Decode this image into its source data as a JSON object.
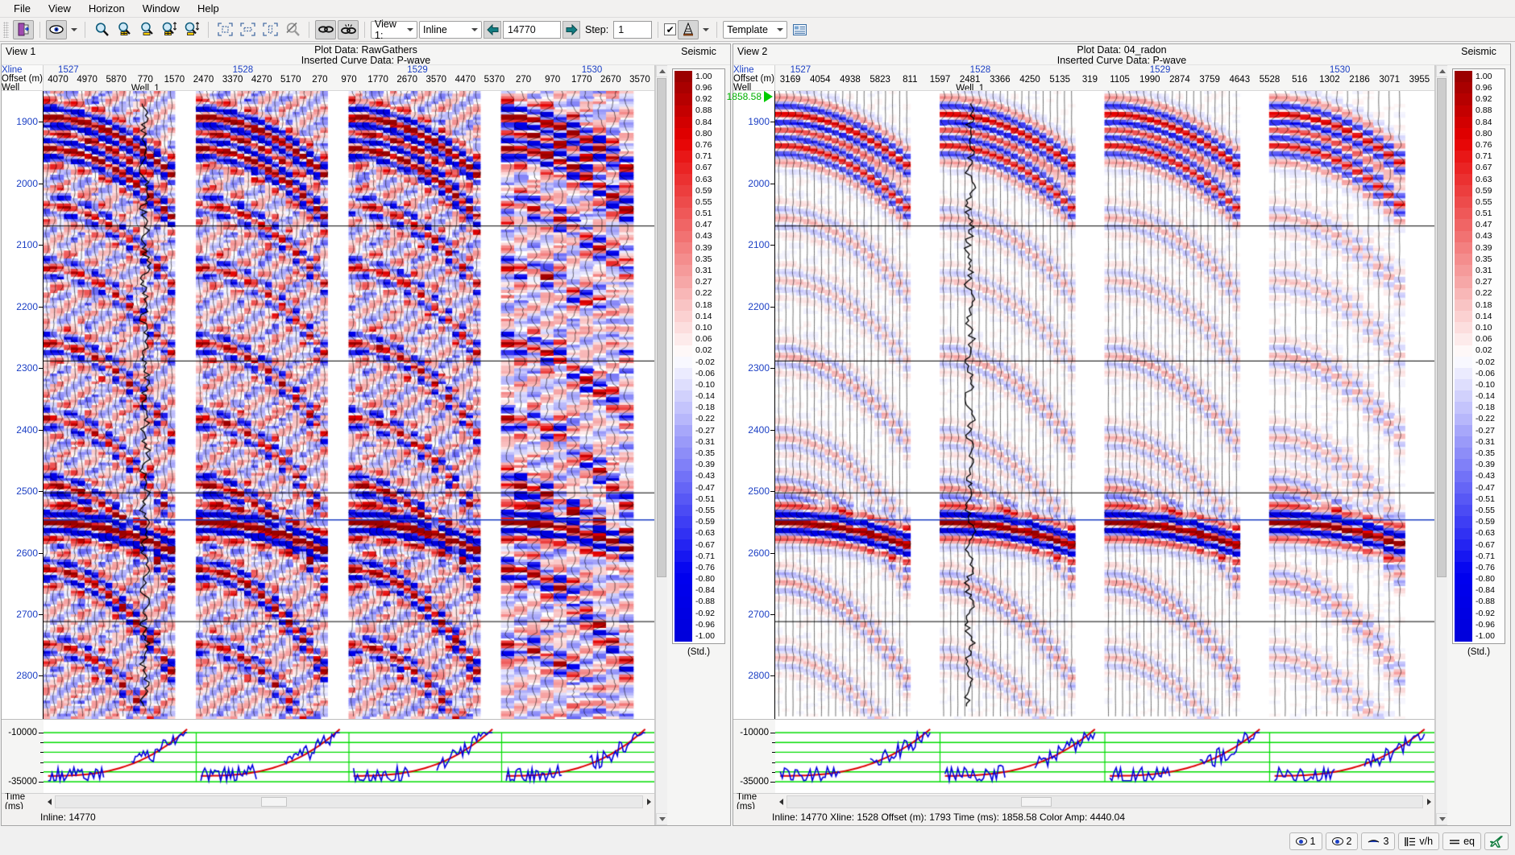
{
  "menu": {
    "items": [
      {
        "label": "File",
        "accel": "F"
      },
      {
        "label": "View",
        "accel": "V"
      },
      {
        "label": "Horizon",
        "accel": "H"
      },
      {
        "label": "Window",
        "accel": "W"
      },
      {
        "label": "Help",
        "accel": "H"
      }
    ]
  },
  "toolbar": {
    "icons": [
      {
        "name": "exit-door-icon",
        "title": "Exit"
      },
      {
        "name": "eye-visibility-icon",
        "title": "Visibility"
      },
      {
        "name": "zoom-icon",
        "title": "Zoom"
      },
      {
        "name": "zoom-in-icon",
        "title": "Zoom In"
      },
      {
        "name": "zoom-out-icon",
        "title": "Zoom Out"
      },
      {
        "name": "zoom-in-vertical-icon",
        "title": "Zoom In Vertical"
      },
      {
        "name": "zoom-out-vertical-icon",
        "title": "Zoom Out Vertical"
      },
      {
        "name": "fit-all-icon",
        "title": "Fit All"
      },
      {
        "name": "fit-horizontal-icon",
        "title": "Fit Horizontal"
      },
      {
        "name": "fit-vertical-icon",
        "title": "Fit Vertical"
      },
      {
        "name": "unzoom-icon",
        "title": "Unzoom"
      },
      {
        "name": "link-views-icon",
        "title": "Link Views"
      },
      {
        "name": "unlink-views-icon",
        "title": "Unlink Views"
      }
    ],
    "view_select": "View 1:",
    "mode_select": "Inline",
    "line_value": "14770",
    "step_label": "Step:",
    "step_value": "1",
    "checkbox_checked": true,
    "template_label": "Template",
    "prev_icon": "left-arrow-icon",
    "next_icon": "right-arrow-icon",
    "cone_icon": "cone-color-icon",
    "properties_icon": "properties-icon"
  },
  "colorbar": {
    "legend_title": "Seismic",
    "units_label": "(Std.)",
    "values": [
      "1.00",
      "0.96",
      "0.92",
      "0.88",
      "0.84",
      "0.80",
      "0.76",
      "0.71",
      "0.67",
      "0.63",
      "0.59",
      "0.55",
      "0.51",
      "0.47",
      "0.43",
      "0.39",
      "0.35",
      "0.31",
      "0.27",
      "0.22",
      "0.18",
      "0.14",
      "0.10",
      "0.06",
      "0.02",
      "-0.02",
      "-0.06",
      "-0.10",
      "-0.14",
      "-0.18",
      "-0.22",
      "-0.27",
      "-0.31",
      "-0.35",
      "-0.39",
      "-0.43",
      "-0.47",
      "-0.51",
      "-0.55",
      "-0.59",
      "-0.63",
      "-0.67",
      "-0.71",
      "-0.76",
      "-0.80",
      "-0.84",
      "-0.88",
      "-0.92",
      "-0.96",
      "-1.00"
    ],
    "positive_color": "#cc0000",
    "negative_color": "#0000e0",
    "neutral_color": "#ffffff"
  },
  "view1": {
    "name": "View 1",
    "plot_data_label": "Plot Data: RawGathers",
    "inserted_curve_label": "Inserted Curve Data: P-wave",
    "row_labels": {
      "xline": "Xline",
      "offset": "Offset (m)",
      "well": "Well"
    },
    "xlines": [
      "1527",
      "1528",
      "1529",
      "1530"
    ],
    "offsets": [
      "4070",
      "4970",
      "5870",
      "770",
      "1570",
      "2470",
      "3370",
      "4270",
      "5170",
      "270",
      "970",
      "1770",
      "2670",
      "3570",
      "4470",
      "5370",
      "270",
      "970",
      "1770",
      "2670",
      "3570"
    ],
    "well_name": "Well_1",
    "well_offset_index": 3,
    "time_ticks": [
      "1900",
      "2000",
      "2100",
      "2200",
      "2300",
      "2400",
      "2500",
      "2600",
      "2700",
      "2800"
    ],
    "curve_axis": {
      "top": "-10000",
      "bottom": "-35000"
    },
    "time_axis_label": "Time (ms)",
    "status": "Inline: 14770"
  },
  "view2": {
    "name": "View 2",
    "plot_data_label": "Plot Data: 04_radon",
    "inserted_curve_label": "Inserted Curve Data: P-wave",
    "row_labels": {
      "xline": "Xline",
      "offset": "Offset (m)",
      "well": "Well"
    },
    "xlines": [
      "1527",
      "1528",
      "1529",
      "1530"
    ],
    "offsets": [
      "3169",
      "4054",
      "4938",
      "5823",
      "811",
      "1597",
      "2481",
      "3366",
      "4250",
      "5135",
      "319",
      "1105",
      "1990",
      "2874",
      "3759",
      "4643",
      "5528",
      "516",
      "1302",
      "2186",
      "3071",
      "3955"
    ],
    "well_name": "Well_1",
    "well_offset_index": 6,
    "time_ticks": [
      "1900",
      "2000",
      "2100",
      "2200",
      "2300",
      "2400",
      "2500",
      "2600",
      "2700",
      "2800"
    ],
    "marker_time": "1858.58",
    "marker_color": "#00c000",
    "curve_axis": {
      "top": "-10000",
      "bottom": "-35000"
    },
    "time_axis_label": "Time (ms)",
    "status": "Inline: 14770  Xline: 1528  Offset (m): 1793  Time (ms): 1858.58  Color Amp: 4440.04"
  },
  "statusbar": {
    "buttons": [
      {
        "icon": "eye-icon",
        "label": "1"
      },
      {
        "icon": "eye-icon",
        "label": "2"
      },
      {
        "icon": "eye-closed-icon",
        "label": "3"
      },
      {
        "icon": "vh-ratio-icon",
        "label": "v/h"
      },
      {
        "icon": "equal-icon",
        "label": "eq"
      },
      {
        "icon": "airplane-icon",
        "label": ""
      }
    ]
  }
}
